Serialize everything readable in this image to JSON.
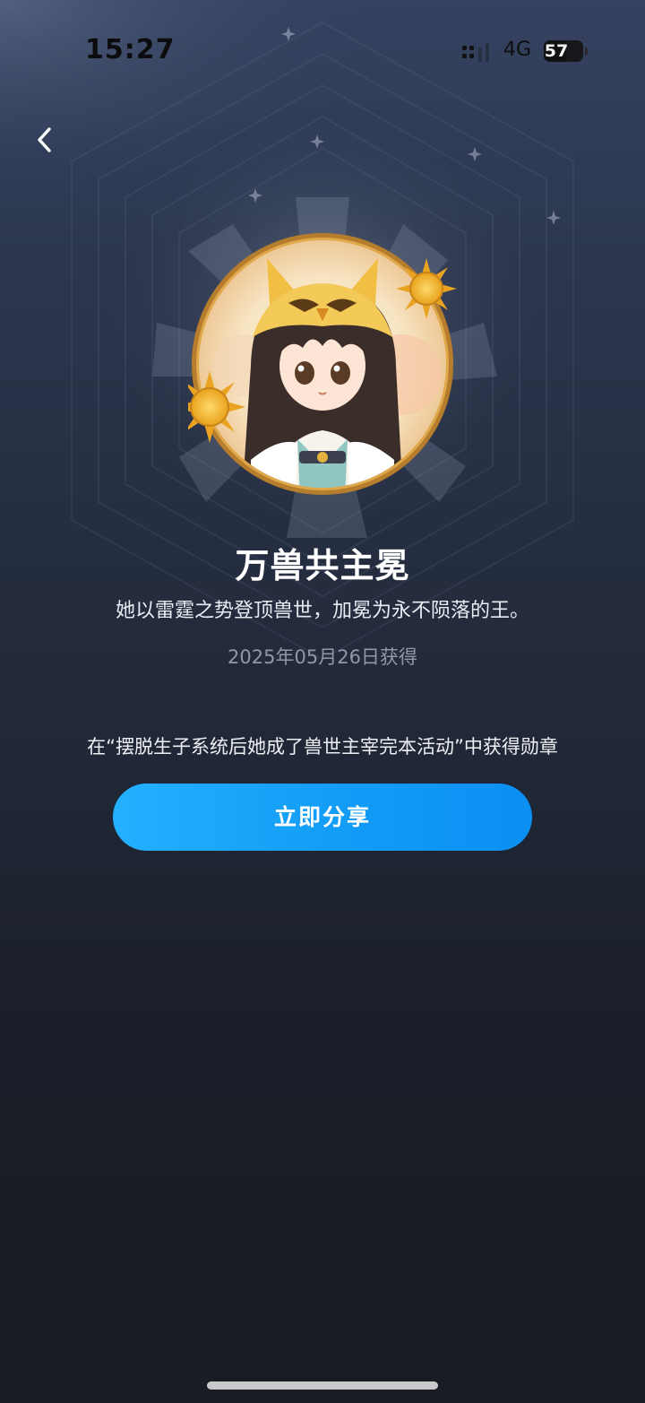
{
  "status_bar": {
    "time": "15:27",
    "network_type": "4G",
    "battery_level": "57",
    "battery_fraction": 0.57,
    "signal_icon": "cellular-signal-icon",
    "battery_icon": "battery-icon"
  },
  "nav": {
    "back_icon": "chevron-left-icon"
  },
  "badge": {
    "image": "medal-portrait-image",
    "title": "万兽共主冕",
    "description": "她以雷霆之势登顶兽世，加冕为永不陨落的王。",
    "obtained_date": "2025年05月26日获得",
    "source": "在“摆脱生子系统后她成了兽世主宰完本活动”中获得勋章"
  },
  "actions": {
    "share_label": "立即分享"
  },
  "colors": {
    "accent": "#129cf6",
    "medal_ring": "#c9913a",
    "sun": "#f2b42c"
  }
}
